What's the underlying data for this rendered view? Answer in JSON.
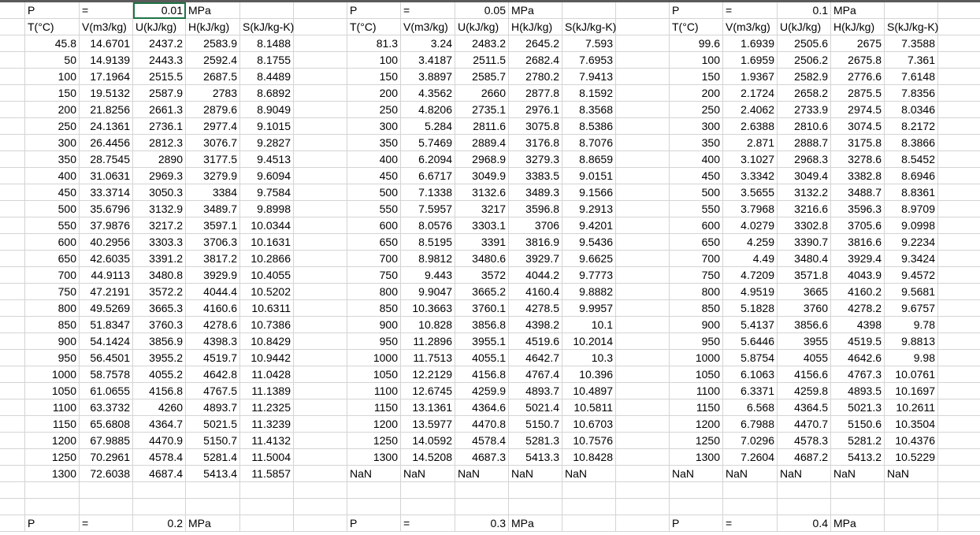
{
  "blocks": [
    {
      "pressure_label": "P",
      "equals": "=",
      "pressure_value": "0.01",
      "unit": "MPa",
      "headers": [
        "T(°C)",
        "V(m3/kg)",
        "U(kJ/kg)",
        "H(kJ/kg)",
        "S(kJ/kg-K)"
      ],
      "rows": [
        [
          "45.8",
          "14.6701",
          "2437.2",
          "2583.9",
          "8.1488"
        ],
        [
          "50",
          "14.9139",
          "2443.3",
          "2592.4",
          "8.1755"
        ],
        [
          "100",
          "17.1964",
          "2515.5",
          "2687.5",
          "8.4489"
        ],
        [
          "150",
          "19.5132",
          "2587.9",
          "2783",
          "8.6892"
        ],
        [
          "200",
          "21.8256",
          "2661.3",
          "2879.6",
          "8.9049"
        ],
        [
          "250",
          "24.1361",
          "2736.1",
          "2977.4",
          "9.1015"
        ],
        [
          "300",
          "26.4456",
          "2812.3",
          "3076.7",
          "9.2827"
        ],
        [
          "350",
          "28.7545",
          "2890",
          "3177.5",
          "9.4513"
        ],
        [
          "400",
          "31.0631",
          "2969.3",
          "3279.9",
          "9.6094"
        ],
        [
          "450",
          "33.3714",
          "3050.3",
          "3384",
          "9.7584"
        ],
        [
          "500",
          "35.6796",
          "3132.9",
          "3489.7",
          "9.8998"
        ],
        [
          "550",
          "37.9876",
          "3217.2",
          "3597.1",
          "10.0344"
        ],
        [
          "600",
          "40.2956",
          "3303.3",
          "3706.3",
          "10.1631"
        ],
        [
          "650",
          "42.6035",
          "3391.2",
          "3817.2",
          "10.2866"
        ],
        [
          "700",
          "44.9113",
          "3480.8",
          "3929.9",
          "10.4055"
        ],
        [
          "750",
          "47.2191",
          "3572.2",
          "4044.4",
          "10.5202"
        ],
        [
          "800",
          "49.5269",
          "3665.3",
          "4160.6",
          "10.6311"
        ],
        [
          "850",
          "51.8347",
          "3760.3",
          "4278.6",
          "10.7386"
        ],
        [
          "900",
          "54.1424",
          "3856.9",
          "4398.3",
          "10.8429"
        ],
        [
          "950",
          "56.4501",
          "3955.2",
          "4519.7",
          "10.9442"
        ],
        [
          "1000",
          "58.7578",
          "4055.2",
          "4642.8",
          "11.0428"
        ],
        [
          "1050",
          "61.0655",
          "4156.8",
          "4767.5",
          "11.1389"
        ],
        [
          "1100",
          "63.3732",
          "4260",
          "4893.7",
          "11.2325"
        ],
        [
          "1150",
          "65.6808",
          "4364.7",
          "5021.5",
          "11.3239"
        ],
        [
          "1200",
          "67.9885",
          "4470.9",
          "5150.7",
          "11.4132"
        ],
        [
          "1250",
          "70.2961",
          "4578.4",
          "5281.4",
          "11.5004"
        ],
        [
          "1300",
          "72.6038",
          "4687.4",
          "5413.4",
          "11.5857"
        ]
      ]
    },
    {
      "pressure_label": "P",
      "equals": "=",
      "pressure_value": "0.05",
      "unit": "MPa",
      "headers": [
        "T(°C)",
        "V(m3/kg)",
        "U(kJ/kg)",
        "H(kJ/kg)",
        "S(kJ/kg-K)"
      ],
      "rows": [
        [
          "81.3",
          "3.24",
          "2483.2",
          "2645.2",
          "7.593"
        ],
        [
          "100",
          "3.4187",
          "2511.5",
          "2682.4",
          "7.6953"
        ],
        [
          "150",
          "3.8897",
          "2585.7",
          "2780.2",
          "7.9413"
        ],
        [
          "200",
          "4.3562",
          "2660",
          "2877.8",
          "8.1592"
        ],
        [
          "250",
          "4.8206",
          "2735.1",
          "2976.1",
          "8.3568"
        ],
        [
          "300",
          "5.284",
          "2811.6",
          "3075.8",
          "8.5386"
        ],
        [
          "350",
          "5.7469",
          "2889.4",
          "3176.8",
          "8.7076"
        ],
        [
          "400",
          "6.2094",
          "2968.9",
          "3279.3",
          "8.8659"
        ],
        [
          "450",
          "6.6717",
          "3049.9",
          "3383.5",
          "9.0151"
        ],
        [
          "500",
          "7.1338",
          "3132.6",
          "3489.3",
          "9.1566"
        ],
        [
          "550",
          "7.5957",
          "3217",
          "3596.8",
          "9.2913"
        ],
        [
          "600",
          "8.0576",
          "3303.1",
          "3706",
          "9.4201"
        ],
        [
          "650",
          "8.5195",
          "3391",
          "3816.9",
          "9.5436"
        ],
        [
          "700",
          "8.9812",
          "3480.6",
          "3929.7",
          "9.6625"
        ],
        [
          "750",
          "9.443",
          "3572",
          "4044.2",
          "9.7773"
        ],
        [
          "800",
          "9.9047",
          "3665.2",
          "4160.4",
          "9.8882"
        ],
        [
          "850",
          "10.3663",
          "3760.1",
          "4278.5",
          "9.9957"
        ],
        [
          "900",
          "10.828",
          "3856.8",
          "4398.2",
          "10.1"
        ],
        [
          "950",
          "11.2896",
          "3955.1",
          "4519.6",
          "10.2014"
        ],
        [
          "1000",
          "11.7513",
          "4055.1",
          "4642.7",
          "10.3"
        ],
        [
          "1050",
          "12.2129",
          "4156.8",
          "4767.4",
          "10.396"
        ],
        [
          "1100",
          "12.6745",
          "4259.9",
          "4893.7",
          "10.4897"
        ],
        [
          "1150",
          "13.1361",
          "4364.6",
          "5021.4",
          "10.5811"
        ],
        [
          "1200",
          "13.5977",
          "4470.8",
          "5150.7",
          "10.6703"
        ],
        [
          "1250",
          "14.0592",
          "4578.4",
          "5281.3",
          "10.7576"
        ],
        [
          "1300",
          "14.5208",
          "4687.3",
          "5413.3",
          "10.8428"
        ],
        [
          "NaN",
          "NaN",
          "NaN",
          "NaN",
          "NaN"
        ]
      ]
    },
    {
      "pressure_label": "P",
      "equals": "=",
      "pressure_value": "0.1",
      "unit": "MPa",
      "headers": [
        "T(°C)",
        "V(m3/kg)",
        "U(kJ/kg)",
        "H(kJ/kg)",
        "S(kJ/kg-K)"
      ],
      "rows": [
        [
          "99.6",
          "1.6939",
          "2505.6",
          "2675",
          "7.3588"
        ],
        [
          "100",
          "1.6959",
          "2506.2",
          "2675.8",
          "7.361"
        ],
        [
          "150",
          "1.9367",
          "2582.9",
          "2776.6",
          "7.6148"
        ],
        [
          "200",
          "2.1724",
          "2658.2",
          "2875.5",
          "7.8356"
        ],
        [
          "250",
          "2.4062",
          "2733.9",
          "2974.5",
          "8.0346"
        ],
        [
          "300",
          "2.6388",
          "2810.6",
          "3074.5",
          "8.2172"
        ],
        [
          "350",
          "2.871",
          "2888.7",
          "3175.8",
          "8.3866"
        ],
        [
          "400",
          "3.1027",
          "2968.3",
          "3278.6",
          "8.5452"
        ],
        [
          "450",
          "3.3342",
          "3049.4",
          "3382.8",
          "8.6946"
        ],
        [
          "500",
          "3.5655",
          "3132.2",
          "3488.7",
          "8.8361"
        ],
        [
          "550",
          "3.7968",
          "3216.6",
          "3596.3",
          "8.9709"
        ],
        [
          "600",
          "4.0279",
          "3302.8",
          "3705.6",
          "9.0998"
        ],
        [
          "650",
          "4.259",
          "3390.7",
          "3816.6",
          "9.2234"
        ],
        [
          "700",
          "4.49",
          "3480.4",
          "3929.4",
          "9.3424"
        ],
        [
          "750",
          "4.7209",
          "3571.8",
          "4043.9",
          "9.4572"
        ],
        [
          "800",
          "4.9519",
          "3665",
          "4160.2",
          "9.5681"
        ],
        [
          "850",
          "5.1828",
          "3760",
          "4278.2",
          "9.6757"
        ],
        [
          "900",
          "5.4137",
          "3856.6",
          "4398",
          "9.78"
        ],
        [
          "950",
          "5.6446",
          "3955",
          "4519.5",
          "9.8813"
        ],
        [
          "1000",
          "5.8754",
          "4055",
          "4642.6",
          "9.98"
        ],
        [
          "1050",
          "6.1063",
          "4156.6",
          "4767.3",
          "10.0761"
        ],
        [
          "1100",
          "6.3371",
          "4259.8",
          "4893.5",
          "10.1697"
        ],
        [
          "1150",
          "6.568",
          "4364.5",
          "5021.3",
          "10.2611"
        ],
        [
          "1200",
          "6.7988",
          "4470.7",
          "5150.6",
          "10.3504"
        ],
        [
          "1250",
          "7.0296",
          "4578.3",
          "5281.2",
          "10.4376"
        ],
        [
          "1300",
          "7.2604",
          "4687.2",
          "5413.2",
          "10.5229"
        ],
        [
          "NaN",
          "NaN",
          "NaN",
          "NaN",
          "NaN"
        ]
      ]
    }
  ],
  "next_blocks": [
    {
      "pressure_label": "P",
      "equals": "=",
      "pressure_value": "0.2",
      "unit": "MPa"
    },
    {
      "pressure_label": "P",
      "equals": "=",
      "pressure_value": "0.3",
      "unit": "MPa"
    },
    {
      "pressure_label": "P",
      "equals": "=",
      "pressure_value": "0.4",
      "unit": "MPa"
    }
  ]
}
